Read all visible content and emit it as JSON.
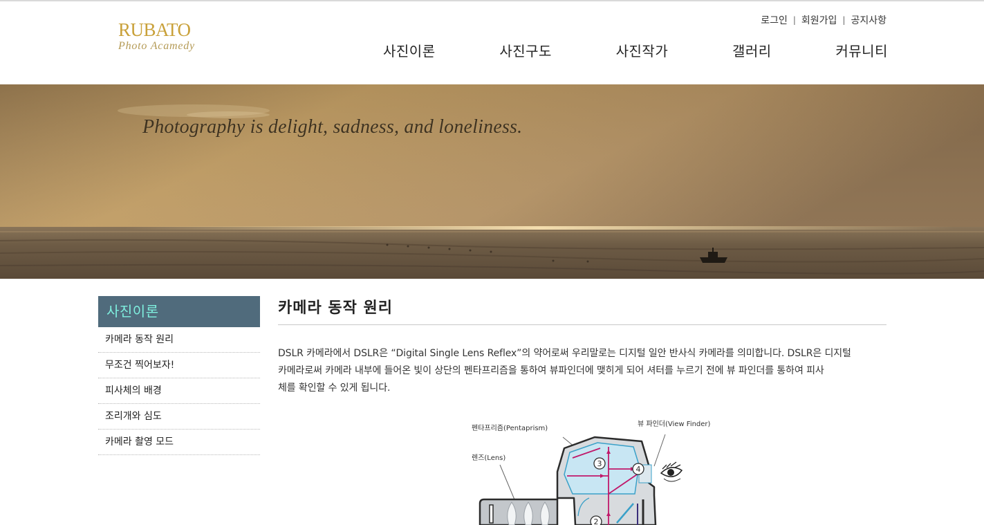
{
  "brand": {
    "name": "RUBATO",
    "subtitle": "Photo Acamedy"
  },
  "utility_links": [
    "로그인",
    "회원가입",
    "공지사항"
  ],
  "main_nav": [
    "사진이론",
    "사진구도",
    "사진작가",
    "갤러리",
    "커뮤니티"
  ],
  "banner": {
    "quote": "Photography is delight, sadness, and loneliness."
  },
  "sidebar": {
    "title": "사진이론",
    "items": [
      "카메라 동작 원리",
      "무조건 찍어보자!",
      "피사체의 배경",
      "조리개와 심도",
      "카메라 촬영 모드"
    ]
  },
  "content": {
    "title": "카메라 동작 원리",
    "paragraph_line1": "DSLR 카메라에서 DSLR은 “Digital Single Lens Reflex”의 약어로써 우리말로는 디지털 일안 반사식 카메라를 의미합니다. DSLR은 디지털",
    "paragraph_line2": "카메라로써 카메라 내부에 들어온 빛이 상단의 펜타프리즘을 통하여 뷰파인더에 맺히게 되어 셔터를 누르기 전에 뷰 파인더를 통하여 피사",
    "paragraph_line3": "체를 확인할 수 있게 됩니다."
  },
  "diagram": {
    "label_pentaprism": "펜타프리즘(Pentaprism)",
    "label_viewfinder": "뷰 파인더(View Finder)",
    "label_lens": "렌즈(Lens)",
    "marker_2": "2",
    "marker_3": "3",
    "marker_4": "4"
  },
  "colors": {
    "logo_gold": "#c9a13a",
    "sidebar_header_bg": "#506b7c",
    "sidebar_header_text": "#7ff0df",
    "light_path": "#c0186a",
    "mirror_blue": "#3aa0c8"
  },
  "icons": [
    "eye-icon"
  ]
}
